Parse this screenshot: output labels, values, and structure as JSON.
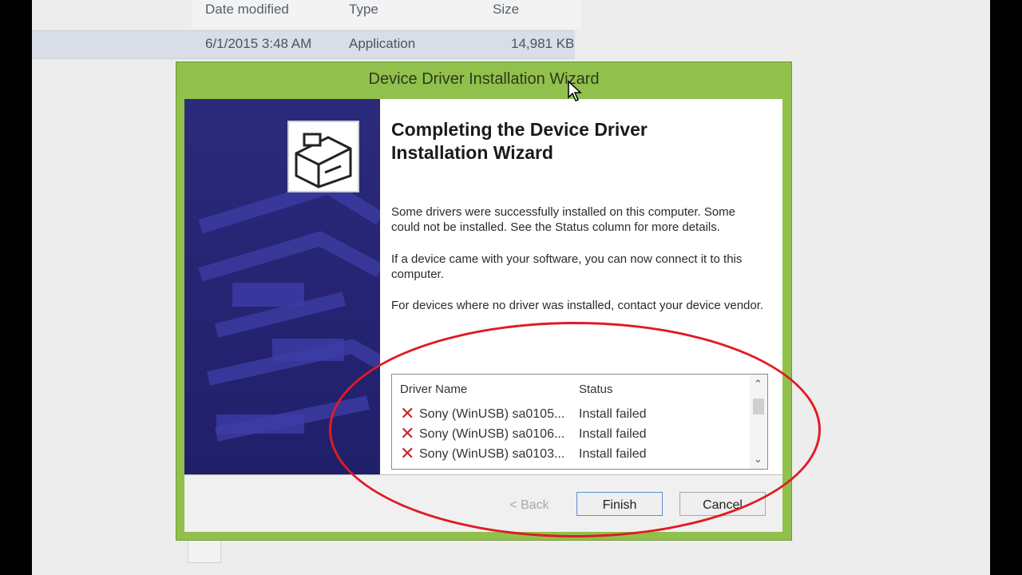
{
  "explorer": {
    "columns": [
      "Date modified",
      "Type",
      "Size"
    ],
    "file": {
      "date_modified": "6/1/2015 3:48 AM",
      "type": "Application",
      "size": "14,981 KB"
    }
  },
  "wizard": {
    "title": "Device Driver Installation Wizard",
    "heading_line1": "Completing the Device Driver",
    "heading_line2": "Installation Wizard",
    "para1": "Some drivers were successfully installed on this computer. Some could not be installed. See the Status column for more details.",
    "para2": "If a device came with your software, you can now connect it to this computer.",
    "para3": "For devices where no driver was installed, contact your device vendor.",
    "table": {
      "headers": [
        "Driver Name",
        "Status"
      ],
      "rows": [
        {
          "icon": "error-x-icon",
          "name": "Sony (WinUSB) sa0105...",
          "status": "Install failed"
        },
        {
          "icon": "error-x-icon",
          "name": "Sony (WinUSB) sa0106...",
          "status": "Install failed"
        },
        {
          "icon": "error-x-icon",
          "name": "Sony (WinUSB) sa0103...",
          "status": "Install failed"
        }
      ]
    },
    "buttons": {
      "back": "< Back",
      "finish": "Finish",
      "cancel": "Cancel"
    }
  },
  "colors": {
    "title_bar": "#91c04d",
    "art_background": "#2b2a7c",
    "error_icon": "#c62828",
    "highlight_circle": "#e11b22"
  }
}
